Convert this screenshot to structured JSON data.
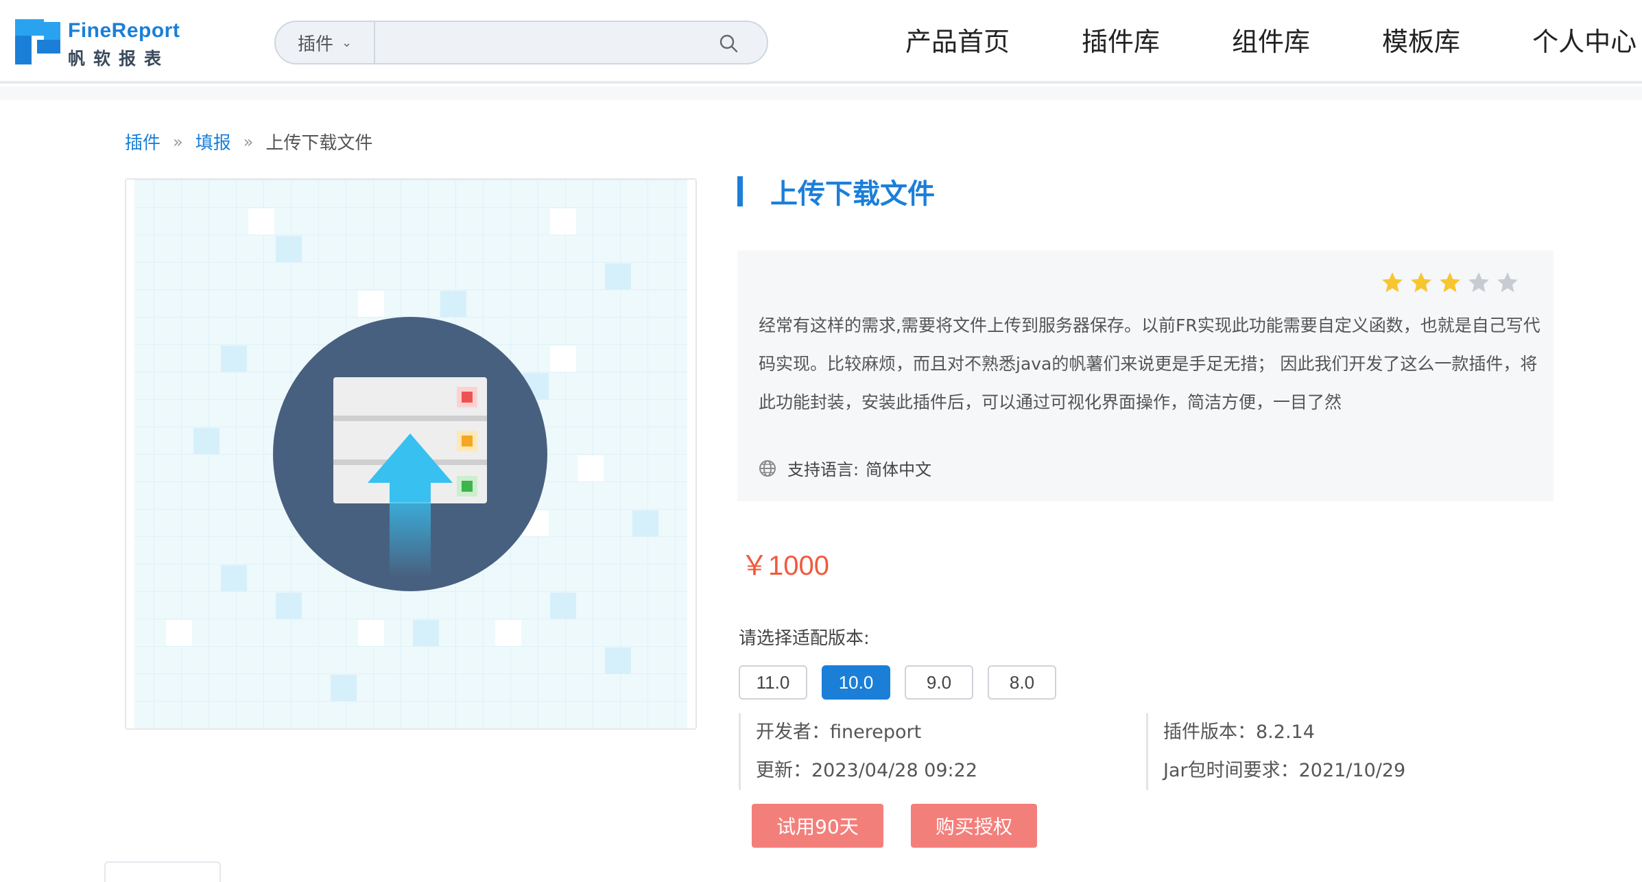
{
  "brand": {
    "name_en": "FineReport",
    "name_cn": "帆软报表",
    "logo_icon": "finereport-logo-icon",
    "color": "#1b7fd8"
  },
  "search": {
    "category": "插件",
    "value": "",
    "placeholder": "",
    "icon": "search-icon"
  },
  "nav": {
    "items": [
      "产品首页",
      "插件库",
      "组件库",
      "模板库",
      "个人中心"
    ]
  },
  "breadcrumb": {
    "items": [
      "插件",
      "填报"
    ],
    "separator": "»",
    "current": "上传下载文件"
  },
  "plugin": {
    "title": "上传下载文件",
    "rating": 3,
    "rating_max": 5,
    "description": "经常有这样的需求,需要将文件上传到服务器保存。以前FR实现此功能需要自定义函数，也就是自己写代码实现。比较麻烦，而且对不熟悉java的帆薯们来说更是手足无措； 因此我们开发了这么一款插件，将此功能封装，安装此插件后，可以通过可视化界面操作，简洁方便，一目了然",
    "language_label": "支持语言:",
    "language": "简体中文",
    "price": "￥1000",
    "price_color": "#f05a3d"
  },
  "versions": {
    "label": "请选择适配版本:",
    "options": [
      "11.0",
      "10.0",
      "9.0",
      "8.0"
    ],
    "selected": "10.0"
  },
  "meta": {
    "developer": "开发者：finereport",
    "updated": "更新：2023/04/28 09:22",
    "plugin_version": "插件版本：8.2.14",
    "jar_requirement": "Jar包时间要求：2021/10/29"
  },
  "actions": {
    "trial": "试用90天",
    "buy": "购买授权",
    "color": "#f37f7b"
  }
}
